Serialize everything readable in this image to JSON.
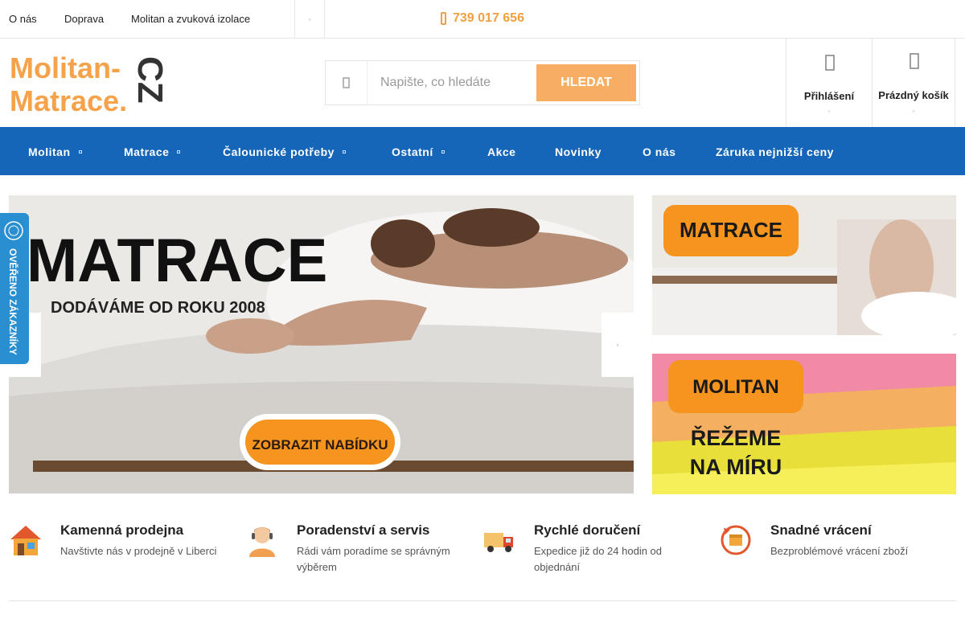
{
  "topbar": {
    "links": [
      "O nás",
      "Doprava",
      "Molitan a zvuková izolace"
    ],
    "phone": "739 017 656"
  },
  "search": {
    "placeholder": "Napište, co hledáte",
    "button": "HLEDAT"
  },
  "header": {
    "login": "Přihlášení",
    "cart": "Prázdný košík"
  },
  "logo": {
    "text_top": "Molitan-",
    "text_bottom": "Matrace.",
    "tld": "CZ"
  },
  "nav": {
    "items": [
      {
        "label": "Molitan"
      },
      {
        "label": "Matrace"
      },
      {
        "label": "Čalounické potřeby"
      },
      {
        "label": "Ostatní"
      },
      {
        "label": "Akce"
      },
      {
        "label": "Novinky"
      },
      {
        "label": "O nás"
      },
      {
        "label": "Záruka nejnižší ceny"
      }
    ]
  },
  "banner": {
    "title": "MATRACE",
    "subtitle": "DODÁVÁME OD ROKU 2008",
    "cta": "ZOBRAZIT NABÍDKU"
  },
  "side_banners": {
    "matrace": "MATRACE",
    "molitan": "MOLITAN",
    "molitan_line1": "ŘEŽEME",
    "molitan_line2": "NA MÍRU"
  },
  "verified": {
    "label": "OVĚŘENO ZÁKAZNÍKY"
  },
  "features": [
    {
      "title": "Kamenná prodejna",
      "desc": "Navštivte nás v prodejně v Liberci"
    },
    {
      "title": "Poradenství a servis",
      "desc": "Rádi vám poradíme se správným výběrem"
    },
    {
      "title": "Rychlé doručení",
      "desc": "Expedice již do 24 hodin od objednání"
    },
    {
      "title": "Snadné vrácení",
      "desc": "Bezproblémové vrácení zboží"
    }
  ],
  "colors": {
    "accent": "#f7ae62",
    "phone": "#f0a040",
    "nav": "#1565b8",
    "banner_orange": "#f5941e",
    "verified": "#2a8fd0"
  },
  "icons": [
    "phone-icon",
    "search-icon",
    "user-icon",
    "cart-icon",
    "store-icon",
    "support-icon",
    "truck-icon",
    "return-icon"
  ]
}
